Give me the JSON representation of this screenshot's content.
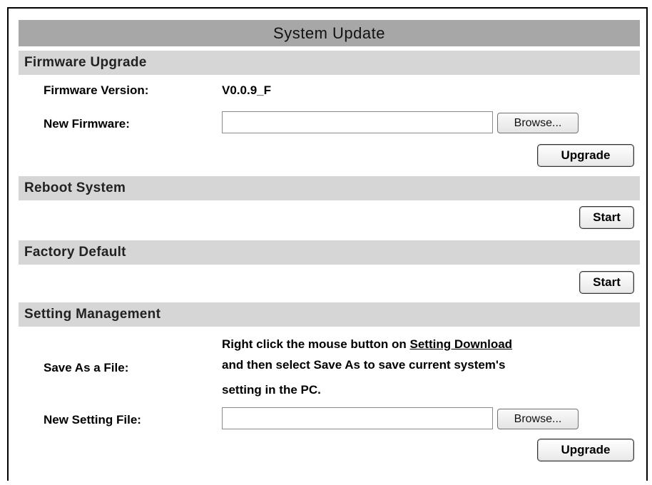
{
  "page": {
    "title": "System Update"
  },
  "firmware_upgrade": {
    "heading": "Firmware Upgrade",
    "version_label": "Firmware Version:",
    "version_value": "V0.0.9_F",
    "new_firmware_label": "New Firmware:",
    "new_firmware_value": "",
    "browse_label": "Browse...",
    "upgrade_label": "Upgrade"
  },
  "reboot_system": {
    "heading": "Reboot System",
    "start_label": "Start"
  },
  "factory_default": {
    "heading": "Factory Default",
    "start_label": "Start"
  },
  "setting_management": {
    "heading": "Setting Management",
    "save_as_label": "Save As a File:",
    "desc_part1": "Right click the mouse button on ",
    "desc_link": "Setting Download",
    "desc_line2": "and then select Save As to save current system's",
    "desc_line3": "setting in the PC.",
    "new_setting_label": "New Setting File:",
    "new_setting_value": "",
    "browse_label": "Browse...",
    "upgrade_label": "Upgrade"
  }
}
